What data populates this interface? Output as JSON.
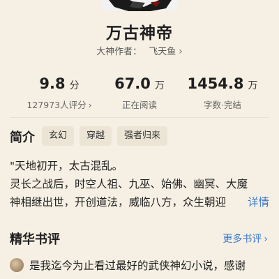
{
  "book": {
    "title": "万古神帝",
    "author_label": "大神作者：",
    "author_name": "飞天鱼"
  },
  "stats": [
    {
      "value": "9.8",
      "unit": "分",
      "sub": "127973人评分"
    },
    {
      "value": "67.0",
      "unit": "万",
      "sub": "正在阅读"
    },
    {
      "value": "1454.8",
      "unit": "万",
      "sub": "字数·完结"
    }
  ],
  "intro": {
    "heading": "简介",
    "tags": [
      "玄幻",
      "穿越",
      "强者归来"
    ],
    "lines": [
      "\"天地初开，太古混乱。",
      "灵长之战后，时空人祖、九巫、始佛、幽冥、大魔",
      "神相继出世，开创道法，威临八方，众生朝迎"
    ],
    "more_label": "详情"
  },
  "reviews": {
    "heading": "精华书评",
    "more_label": "更多书评",
    "first_review": "是我迄今为止看过最好的武侠神幻小说，感谢"
  },
  "icons": {
    "chevron": "chevron-right-icon"
  },
  "colors": {
    "background": "#f6f0e4",
    "link": "#3a79c9",
    "tag_bg": "#ece5d6"
  }
}
